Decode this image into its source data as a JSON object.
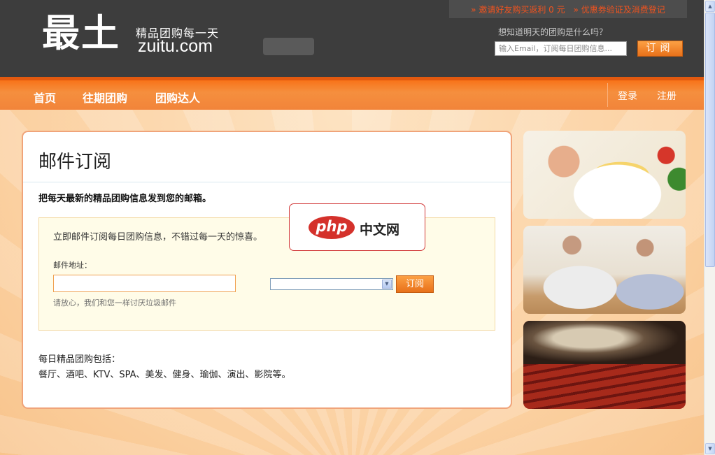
{
  "header": {
    "logo": "最土",
    "slogan": "精品团购每一天",
    "domain": "zuitu.com",
    "top_links": [
      "» 邀请好友购买返利 0 元",
      "» 优惠券验证及消费登记"
    ],
    "subscribe_question": "想知道明天的团购是什么吗？",
    "subscribe_placeholder": "输入Email，订阅每日团购信息...",
    "subscribe_button": "订阅"
  },
  "nav": {
    "items": [
      "首页",
      "往期团购",
      "团购达人"
    ],
    "login": "登录",
    "register": "注册"
  },
  "main": {
    "title": "邮件订阅",
    "lead": "把每天最新的精品团购信息发到您的邮箱。",
    "intro": "立即邮件订阅每日团购信息，不错过每一天的惊喜。",
    "email_label": "邮件地址：",
    "email_value": "",
    "city_value": "",
    "submit": "订阅",
    "note": "请放心，我们和您一样讨厌垃圾邮件",
    "includes_title": "每日精品团购包括：",
    "includes_list": "餐厅、酒吧、KTV、SPA、美发、健身、瑜伽、演出、影院等。"
  },
  "watermark": {
    "logo": "php",
    "text": "中文网"
  },
  "sidebar_images": [
    "food-photo",
    "yoga-photo",
    "theater-photo"
  ]
}
